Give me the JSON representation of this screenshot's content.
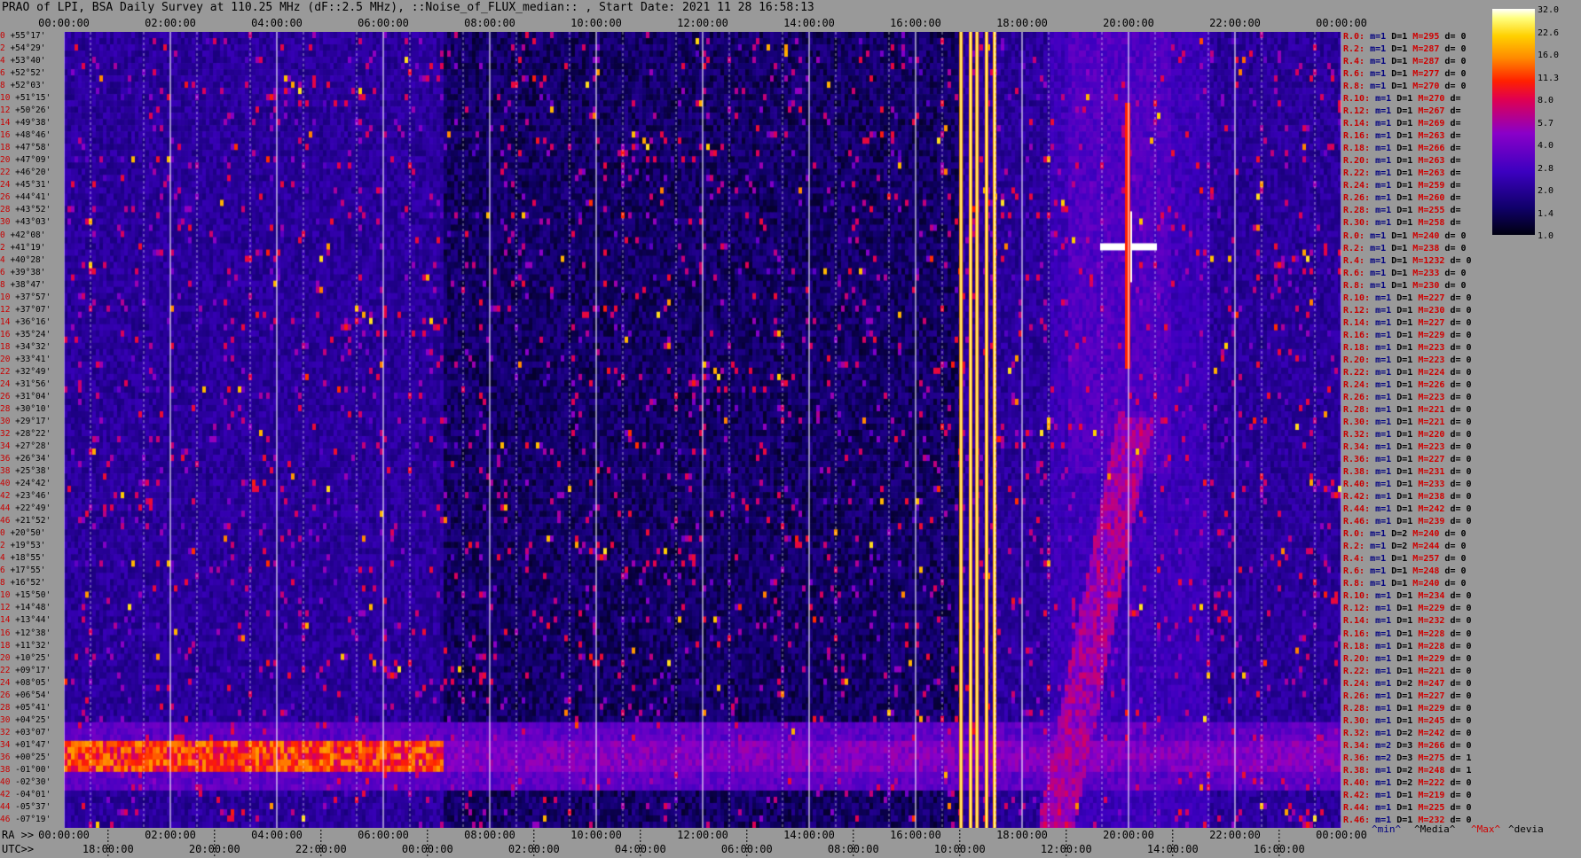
{
  "title": "PRAO of LPI, BSA Daily Survey at 110.25 MHz (dF::2.5 MHz), ::Noise_of_FLUX_median:: , Start Date: 2021 11 28 16:58:13",
  "top_ticks": [
    "00:00:00",
    "02:00:00",
    "04:00:00",
    "06:00:00",
    "08:00:00",
    "10:00:00",
    "12:00:00",
    "14:00:00",
    "16:00:00",
    "18:00:00",
    "20:00:00",
    "22:00:00",
    "00:00:00"
  ],
  "ra_label": "RA >>",
  "ra_ticks": [
    "00:00:00",
    "02:00:00",
    "04:00:00",
    "06:00:00",
    "08:00:00",
    "10:00:00",
    "12:00:00",
    "14:00:00",
    "16:00:00",
    "18:00:00",
    "20:00:00",
    "22:00:00",
    "00:00:00"
  ],
  "utc_label": "UTC>>",
  "utc_ticks": [
    "18:00:00",
    "20:00:00",
    "22:00:00",
    "00:00:00",
    "02:00:00",
    "04:00:00",
    "06:00:00",
    "08:00:00",
    "10:00:00",
    "12:00:00",
    "14:00:00",
    "16:00:00"
  ],
  "colorbar_ticks": [
    "32.0",
    "22.6",
    "16.0",
    "11.3",
    "8.0",
    "5.7",
    "4.0",
    "2.8",
    "2.0",
    "1.4",
    "1.0"
  ],
  "legend": {
    "min": "^min^",
    "median": "^Media^",
    "max": "^Max^",
    "dev": "^devia"
  },
  "declinations": [
    "+55°17'",
    "+54°29'",
    "+53°40'",
    "+52°52'",
    "+52°03'",
    "+51°15'",
    "+50°26'",
    "+49°38'",
    "+48°46'",
    "+47°58'",
    "+47°09'",
    "+46°20'",
    "+45°31'",
    "+44°41'",
    "+43°52'",
    "+43°03'",
    "+42°08'",
    "+41°19'",
    "+40°28'",
    "+39°38'",
    "+38°47'",
    "+37°57'",
    "+37°07'",
    "+36°16'",
    "+35°24'",
    "+34°32'",
    "+33°41'",
    "+32°49'",
    "+31°56'",
    "+31°04'",
    "+30°10'",
    "+29°17'",
    "+28°22'",
    "+27°28'",
    "+26°34'",
    "+25°38'",
    "+24°42'",
    "+23°46'",
    "+22°49'",
    "+21°52'",
    "+20°50'",
    "+19°53'",
    "+18°55'",
    "+17°55'",
    "+16°52'",
    "+15°50'",
    "+14°48'",
    "+13°44'",
    "+12°38'",
    "+11°32'",
    "+10°25'",
    "+09°17'",
    "+08°05'",
    "+06°54'",
    "+05°41'",
    "+04°25'",
    "+03°07'",
    "+01°47'",
    "+00°25'",
    "-01°00'",
    "-02°30'",
    "-04°01'",
    "-05°37'",
    "-07°19'"
  ],
  "row_indices": [
    "0",
    "2",
    "4",
    "6",
    "8",
    "10",
    "12",
    "14",
    "16",
    "18",
    "20",
    "22",
    "24",
    "26",
    "28",
    "30",
    "0",
    "2",
    "4",
    "6",
    "8",
    "10",
    "12",
    "14",
    "16",
    "18",
    "20",
    "22",
    "24",
    "26",
    "28",
    "30",
    "32",
    "34",
    "36",
    "38",
    "40",
    "42",
    "44",
    "46",
    "0",
    "2",
    "4",
    "6",
    "8",
    "10",
    "12",
    "14",
    "16",
    "18",
    "20",
    "22",
    "24",
    "26",
    "28",
    "30",
    "32",
    "34",
    "36",
    "38",
    "40",
    "42",
    "44",
    "46"
  ],
  "stats": [
    {
      "r": "R.0:",
      "m": "m=1",
      "D": "D=1",
      "M": "M=295",
      "d": "d= 0"
    },
    {
      "r": "R.2:",
      "m": "m=1",
      "D": "D=1",
      "M": "M=287",
      "d": "d= 0"
    },
    {
      "r": "R.4:",
      "m": "m=1",
      "D": "D=1",
      "M": "M=287",
      "d": "d= 0"
    },
    {
      "r": "R.6:",
      "m": "m=1",
      "D": "D=1",
      "M": "M=277",
      "d": "d= 0"
    },
    {
      "r": "R.8:",
      "m": "m=1",
      "D": "D=1",
      "M": "M=270",
      "d": "d= 0"
    },
    {
      "r": "R.10:",
      "m": "m=1",
      "D": "D=1",
      "M": "M=270",
      "d": "d="
    },
    {
      "r": "R.12:",
      "m": "m=1",
      "D": "D=1",
      "M": "M=267",
      "d": "d="
    },
    {
      "r": "R.14:",
      "m": "m=1",
      "D": "D=1",
      "M": "M=269",
      "d": "d="
    },
    {
      "r": "R.16:",
      "m": "m=1",
      "D": "D=1",
      "M": "M=263",
      "d": "d="
    },
    {
      "r": "R.18:",
      "m": "m=1",
      "D": "D=1",
      "M": "M=266",
      "d": "d="
    },
    {
      "r": "R.20:",
      "m": "m=1",
      "D": "D=1",
      "M": "M=263",
      "d": "d="
    },
    {
      "r": "R.22:",
      "m": "m=1",
      "D": "D=1",
      "M": "M=263",
      "d": "d="
    },
    {
      "r": "R.24:",
      "m": "m=1",
      "D": "D=1",
      "M": "M=259",
      "d": "d="
    },
    {
      "r": "R.26:",
      "m": "m=1",
      "D": "D=1",
      "M": "M=260",
      "d": "d="
    },
    {
      "r": "R.28:",
      "m": "m=1",
      "D": "D=1",
      "M": "M=255",
      "d": "d="
    },
    {
      "r": "R.30:",
      "m": "m=1",
      "D": "D=1",
      "M": "M=258",
      "d": "d="
    },
    {
      "r": "R.0:",
      "m": "m=1",
      "D": "D=1",
      "M": "M=240",
      "d": "d= 0"
    },
    {
      "r": "R.2:",
      "m": "m=1",
      "D": "D=1",
      "M": "M=238",
      "d": "d= 0"
    },
    {
      "r": "R.4:",
      "m": "m=1",
      "D": "D=1",
      "M": "M=1232",
      "d": "d= 0"
    },
    {
      "r": "R.6:",
      "m": "m=1",
      "D": "D=1",
      "M": "M=233",
      "d": "d= 0"
    },
    {
      "r": "R.8:",
      "m": "m=1",
      "D": "D=1",
      "M": "M=230",
      "d": "d= 0"
    },
    {
      "r": "R.10:",
      "m": "m=1",
      "D": "D=1",
      "M": "M=227",
      "d": "d= 0"
    },
    {
      "r": "R.12:",
      "m": "m=1",
      "D": "D=1",
      "M": "M=230",
      "d": "d= 0"
    },
    {
      "r": "R.14:",
      "m": "m=1",
      "D": "D=1",
      "M": "M=227",
      "d": "d= 0"
    },
    {
      "r": "R.16:",
      "m": "m=1",
      "D": "D=1",
      "M": "M=229",
      "d": "d= 0"
    },
    {
      "r": "R.18:",
      "m": "m=1",
      "D": "D=1",
      "M": "M=223",
      "d": "d= 0"
    },
    {
      "r": "R.20:",
      "m": "m=1",
      "D": "D=1",
      "M": "M=223",
      "d": "d= 0"
    },
    {
      "r": "R.22:",
      "m": "m=1",
      "D": "D=1",
      "M": "M=224",
      "d": "d= 0"
    },
    {
      "r": "R.24:",
      "m": "m=1",
      "D": "D=1",
      "M": "M=226",
      "d": "d= 0"
    },
    {
      "r": "R.26:",
      "m": "m=1",
      "D": "D=1",
      "M": "M=223",
      "d": "d= 0"
    },
    {
      "r": "R.28:",
      "m": "m=1",
      "D": "D=1",
      "M": "M=221",
      "d": "d= 0"
    },
    {
      "r": "R.30:",
      "m": "m=1",
      "D": "D=1",
      "M": "M=221",
      "d": "d= 0"
    },
    {
      "r": "R.32:",
      "m": "m=1",
      "D": "D=1",
      "M": "M=220",
      "d": "d= 0"
    },
    {
      "r": "R.34:",
      "m": "m=1",
      "D": "D=1",
      "M": "M=223",
      "d": "d= 0"
    },
    {
      "r": "R.36:",
      "m": "m=1",
      "D": "D=1",
      "M": "M=227",
      "d": "d= 0"
    },
    {
      "r": "R.38:",
      "m": "m=1",
      "D": "D=1",
      "M": "M=231",
      "d": "d= 0"
    },
    {
      "r": "R.40:",
      "m": "m=1",
      "D": "D=1",
      "M": "M=233",
      "d": "d= 0"
    },
    {
      "r": "R.42:",
      "m": "m=1",
      "D": "D=1",
      "M": "M=238",
      "d": "d= 0"
    },
    {
      "r": "R.44:",
      "m": "m=1",
      "D": "D=1",
      "M": "M=242",
      "d": "d= 0"
    },
    {
      "r": "R.46:",
      "m": "m=1",
      "D": "D=1",
      "M": "M=239",
      "d": "d= 0"
    },
    {
      "r": "R.0:",
      "m": "m=1",
      "D": "D=2",
      "M": "M=240",
      "d": "d= 0"
    },
    {
      "r": "R.2:",
      "m": "m=1",
      "D": "D=2",
      "M": "M=244",
      "d": "d= 0"
    },
    {
      "r": "R.4:",
      "m": "m=1",
      "D": "D=1",
      "M": "M=257",
      "d": "d= 0"
    },
    {
      "r": "R.6:",
      "m": "m=1",
      "D": "D=1",
      "M": "M=248",
      "d": "d= 0"
    },
    {
      "r": "R.8:",
      "m": "m=1",
      "D": "D=1",
      "M": "M=240",
      "d": "d= 0"
    },
    {
      "r": "R.10:",
      "m": "m=1",
      "D": "D=1",
      "M": "M=234",
      "d": "d= 0"
    },
    {
      "r": "R.12:",
      "m": "m=1",
      "D": "D=1",
      "M": "M=229",
      "d": "d= 0"
    },
    {
      "r": "R.14:",
      "m": "m=1",
      "D": "D=1",
      "M": "M=232",
      "d": "d= 0"
    },
    {
      "r": "R.16:",
      "m": "m=1",
      "D": "D=1",
      "M": "M=228",
      "d": "d= 0"
    },
    {
      "r": "R.18:",
      "m": "m=1",
      "D": "D=1",
      "M": "M=228",
      "d": "d= 0"
    },
    {
      "r": "R.20:",
      "m": "m=1",
      "D": "D=1",
      "M": "M=229",
      "d": "d= 0"
    },
    {
      "r": "R.22:",
      "m": "m=1",
      "D": "D=1",
      "M": "M=221",
      "d": "d= 0"
    },
    {
      "r": "R.24:",
      "m": "m=1",
      "D": "D=2",
      "M": "M=247",
      "d": "d= 0"
    },
    {
      "r": "R.26:",
      "m": "m=1",
      "D": "D=1",
      "M": "M=227",
      "d": "d= 0"
    },
    {
      "r": "R.28:",
      "m": "m=1",
      "D": "D=1",
      "M": "M=229",
      "d": "d= 0"
    },
    {
      "r": "R.30:",
      "m": "m=1",
      "D": "D=1",
      "M": "M=245",
      "d": "d= 0"
    },
    {
      "r": "R.32:",
      "m": "m=1",
      "D": "D=2",
      "M": "M=242",
      "d": "d= 0"
    },
    {
      "r": "R.34:",
      "m": "m=2",
      "D": "D=3",
      "M": "M=266",
      "d": "d= 0"
    },
    {
      "r": "R.36:",
      "m": "m=2",
      "D": "D=3",
      "M": "M=275",
      "d": "d= 1"
    },
    {
      "r": "R.38:",
      "m": "m=1",
      "D": "D=2",
      "M": "M=248",
      "d": "d= 1"
    },
    {
      "r": "R.40:",
      "m": "m=1",
      "D": "D=2",
      "M": "M=222",
      "d": "d= 0"
    },
    {
      "r": "R.42:",
      "m": "m=1",
      "D": "D=1",
      "M": "M=219",
      "d": "d= 0"
    },
    {
      "r": "R.44:",
      "m": "m=1",
      "D": "D=1",
      "M": "M=225",
      "d": "d= 0"
    },
    {
      "r": "R.46:",
      "m": "m=1",
      "D": "D=1",
      "M": "M=232",
      "d": "d= 0"
    }
  ],
  "chart_data": {
    "type": "heatmap",
    "title": "PRAO of LPI, BSA Daily Survey at 110.25 MHz (dF::2.5 MHz), ::Noise_of_FLUX_median:: , Start Date: 2021 11 28 16:58:13",
    "x_axis": "RA 00:00:00 – 24:00:00 (UTC 16:58 – 16:58 next day)",
    "y_axis": "Declination +55°17' to -07°19' (64 beams)",
    "color_scale": "log",
    "zlim": [
      1.0,
      32.0
    ],
    "colorbar_ticks": [
      32.0,
      22.6,
      16.0,
      11.3,
      8.0,
      5.7,
      4.0,
      2.8,
      2.0,
      1.4,
      1.0
    ],
    "features": [
      {
        "kind": "interference_band",
        "ra_hours": [
          16.8,
          17.5
        ],
        "value": 16
      },
      {
        "kind": "horizontal_band",
        "dec_range": [
          "+01°47'",
          "-01°00'"
        ],
        "ra_hours": [
          0,
          7.1
        ],
        "value": 11
      },
      {
        "kind": "bright_source",
        "ra_hours": 20.0,
        "dec": "+41°19'",
        "value": 32
      },
      {
        "kind": "arc",
        "ra_hours": [
          18.5,
          20.0
        ],
        "dec_range": [
          "-07°19'",
          "+20°50'"
        ],
        "value": 6
      }
    ]
  }
}
